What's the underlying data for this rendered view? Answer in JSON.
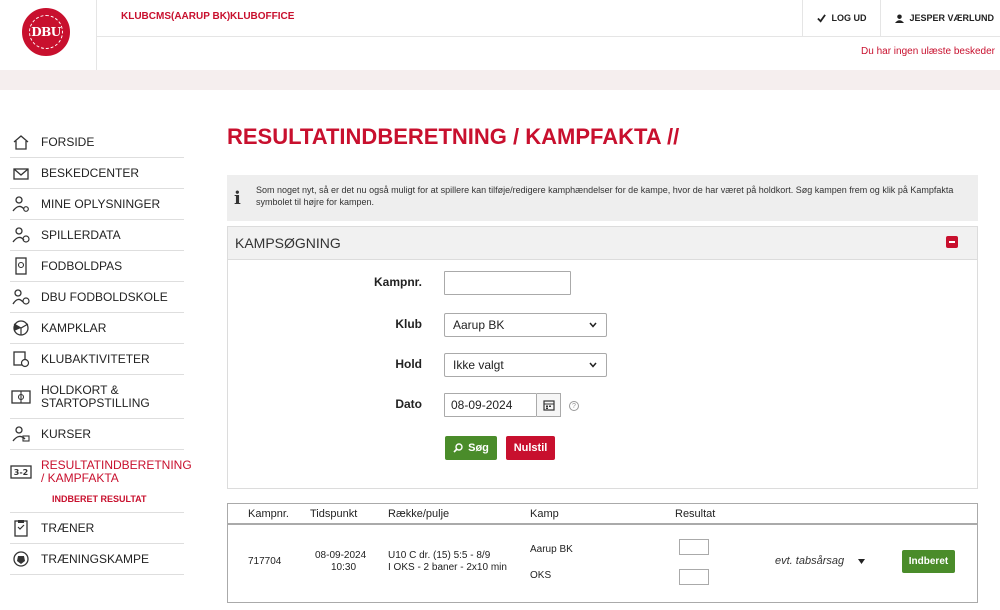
{
  "header": {
    "logo_alt": "DBU",
    "links": [
      "KLUBCMS(AARUP BK)",
      "KLUBOFFICE"
    ],
    "logout": "LOG UD",
    "user": "JESPER VÆRLUND",
    "messages": "Du har ingen ulæste beskeder"
  },
  "sidebar": {
    "items": [
      {
        "label": "FORSIDE",
        "icon": "house-icon"
      },
      {
        "label": "BESKEDCENTER",
        "icon": "envelope-icon"
      },
      {
        "label": "MINE OPLYSNINGER",
        "icon": "user-gear-icon"
      },
      {
        "label": "SPILLERDATA",
        "icon": "player-data-icon"
      },
      {
        "label": "FODBOLDPAS",
        "icon": "passport-icon"
      },
      {
        "label": "DBU FODBOLDSKOLE",
        "icon": "school-icon"
      },
      {
        "label": "KAMPKLAR",
        "icon": "ball-icon"
      },
      {
        "label": "KLUBAKTIVITETER",
        "icon": "activity-icon"
      },
      {
        "label": "HOLDKORT & STARTOPSTILLING",
        "icon": "pitch-icon"
      },
      {
        "label": "KURSER",
        "icon": "course-icon"
      },
      {
        "label": "RESULTATINDBERETNING / KAMPFAKTA",
        "icon": "score-icon"
      },
      {
        "label": "TRÆNER",
        "icon": "clipboard-icon"
      },
      {
        "label": "TRÆNINGSKAMPE",
        "icon": "training-ball-icon"
      }
    ],
    "subitem": "INDBERET RESULTAT"
  },
  "main": {
    "title": "RESULTATINDBERETNING / KAMPFAKTA //",
    "info_icon": "i",
    "info": "Som noget nyt, så er det nu også muligt for at spillere kan tilføje/redigere kamphændelser for de kampe, hvor de har været på holdkort. Søg kampen frem og klik på Kampfakta symbolet til højre for kampen.",
    "panel_title": "KAMPSØGNING",
    "form": {
      "kampnr_label": "Kampnr.",
      "kampnr_value": "",
      "klub_label": "Klub",
      "klub_value": "Aarup BK",
      "hold_label": "Hold",
      "hold_value": "Ikke valgt",
      "dato_label": "Dato",
      "dato_value": "08-09-2024",
      "help": "?",
      "search_button": "Søg",
      "reset_button": "Nulstil"
    },
    "results": {
      "headers": [
        "Kampnr.",
        "Tidspunkt",
        "Række/pulje",
        "Kamp",
        "Resultat"
      ],
      "rows": [
        {
          "kampnr": "717704",
          "date": "08-09-2024",
          "time": "10:30",
          "raekke_1": "U10 C dr. (15) 5:5 - 8/9",
          "raekke_2": "I OKS - 2 baner - 2x10 min",
          "home": "Aarup BK",
          "away": "OKS",
          "home_score": "",
          "away_score": "",
          "reason": "evt. tabsårsag",
          "submit": "Indberet"
        }
      ]
    }
  },
  "colors": {
    "brand_red": "#c8102e",
    "action_green": "#4a8c2a"
  }
}
